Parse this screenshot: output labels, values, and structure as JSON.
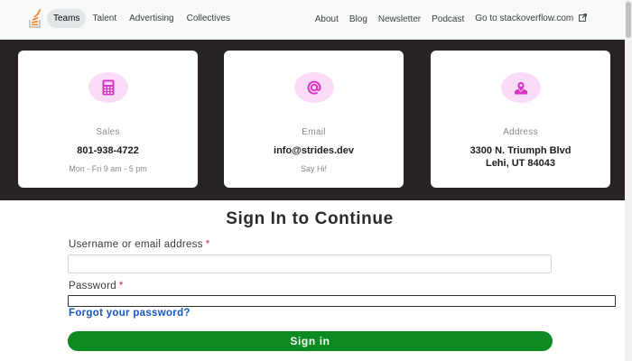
{
  "topnav": {
    "logo_icon": "stackoverflow-logo-icon",
    "left_links": [
      "Teams",
      "Talent",
      "Advertising",
      "Collectives"
    ],
    "active_link": "Teams",
    "right_links": [
      "About",
      "Blog",
      "Newsletter",
      "Podcast"
    ],
    "external_link": "Go to stackoverflow.com",
    "external_icon": "external-link-icon"
  },
  "contact_cards": [
    {
      "icon": "calculator-icon",
      "label": "Sales",
      "value_line1": "801-938-4722",
      "value_line2": "",
      "sub": "Mon - Fri 9 am - 5 pm"
    },
    {
      "icon": "at-sign-icon",
      "label": "Email",
      "value_line1": "info@strides.dev",
      "value_line2": "",
      "sub": "Say Hi!"
    },
    {
      "icon": "map-pin-icon",
      "label": "Address",
      "value_line1": "3300 N. Triumph Blvd",
      "value_line2": "Lehi, UT 84043",
      "sub": ""
    }
  ],
  "signin": {
    "title": "Sign In to Continue",
    "username_label": "Username or email address",
    "password_label": "Password",
    "required_mark": "*",
    "username_value": "",
    "password_value": "",
    "forgot_link": "Forgot your password?",
    "submit_label": "Sign in"
  },
  "colors": {
    "band_bg": "#2a2323",
    "icon_circle": "#fbdcf8",
    "icon_fg": "#d636c4",
    "submit_bg": "#0e8a22",
    "link": "#1a56b8",
    "required": "#d32f2f"
  }
}
